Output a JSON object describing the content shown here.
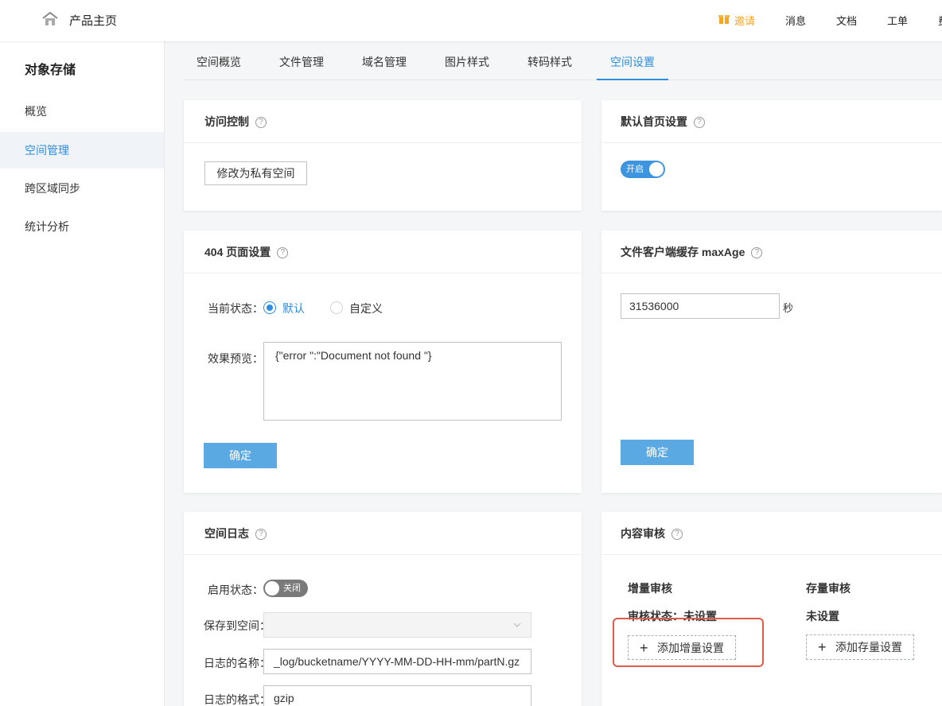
{
  "topbar": {
    "home_title": "产品主页",
    "nav": [
      "邀请",
      "消息",
      "文档",
      "工单",
      "费"
    ]
  },
  "sidebar": {
    "title": "对象存储",
    "items": [
      {
        "label": "概览"
      },
      {
        "label": "空间管理"
      },
      {
        "label": "跨区域同步"
      },
      {
        "label": "统计分析"
      }
    ]
  },
  "tabs": [
    "空间概览",
    "文件管理",
    "域名管理",
    "图片样式",
    "转码样式",
    "空间设置"
  ],
  "access": {
    "title": "访问控制",
    "button": "修改为私有空间"
  },
  "homepage": {
    "title": "默认首页设置",
    "toggle": "开启"
  },
  "page404": {
    "title": "404 页面设置",
    "status_label": "当前状态：",
    "opt_default": "默认",
    "opt_custom": "自定义",
    "preview_label": "效果预览：",
    "preview_text": "{\"error \":\"Document not found \"}",
    "confirm": "确定"
  },
  "maxage": {
    "title": "文件客户端缓存 maxAge",
    "value": "31536000",
    "unit": "秒",
    "confirm": "确定"
  },
  "log": {
    "title": "空间日志",
    "enable_label": "启用状态：",
    "toggle": "关闭",
    "save_label": "保存到空间：",
    "name_label": "日志的名称：",
    "name_value": "_log/bucketname/YYYY-MM-DD-HH-mm/partN.gz",
    "format_label": "日志的格式：",
    "format_value": "gzip"
  },
  "audit": {
    "title": "内容审核",
    "incremental": "增量审核",
    "incremental_status": "审核状态：未设置",
    "add_incremental": "添加增量设置",
    "stock": "存量审核",
    "stock_status": "未设置",
    "add_stock": "添加存量设置"
  },
  "colors": {
    "accent": "#2d8de0",
    "primary_button": "#5aa9e3",
    "invite": "#f5a623",
    "highlight_box": "#e05a4e"
  }
}
